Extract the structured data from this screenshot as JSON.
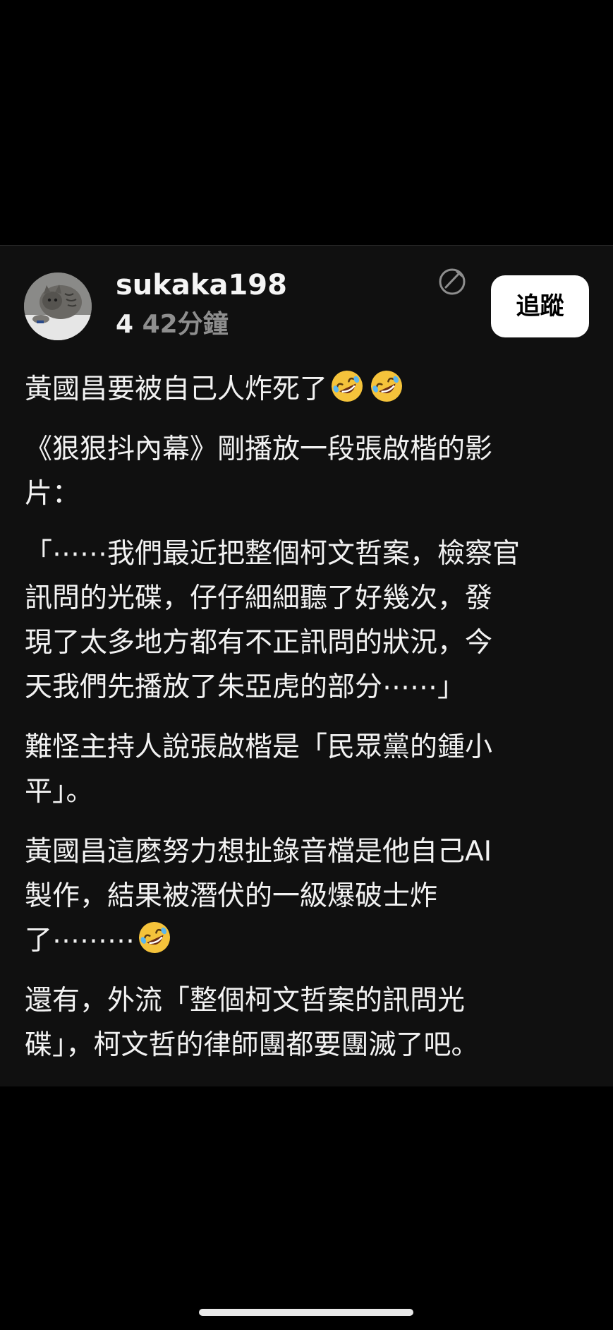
{
  "post": {
    "author": {
      "username": "sukaka198",
      "avatar_icon": "cat-avatar"
    },
    "meta": {
      "count": "4",
      "time": "42分鐘"
    },
    "follow_label": "追蹤",
    "edit_icon": "edited-icon",
    "paragraphs": [
      {
        "text": "黃國昌要被自己人炸死了",
        "trailing_emoji": [
          "rolling-on-floor-laughing-emoji",
          "rolling-on-floor-laughing-emoji"
        ]
      },
      {
        "text": "《狠狠抖內幕》剛播放一段張啟楷的影\n片："
      },
      {
        "text": "「⋯⋯我們最近把整個柯文哲案，檢察官\n訊問的光碟，仔仔細細聽了好幾次，發\n現了太多地方都有不正訊問的狀況，今\n天我們先播放了朱亞虎的部分⋯⋯」"
      },
      {
        "text": "難怪主持人說張啟楷是「民眾黨的鍾小\n平」。"
      },
      {
        "text": "黃國昌這麼努力想扯錄音檔是他自己AI\n製作，結果被潛伏的一級爆破士炸\n了⋯⋯⋯",
        "trailing_emoji": [
          "rolling-on-floor-laughing-emoji"
        ]
      },
      {
        "text": "還有，外流「整個柯文哲案的訊問光\n碟」，柯文哲的律師團都要團滅了吧。"
      }
    ]
  },
  "colors": {
    "background": "#000000",
    "card": "#101010",
    "text": "#f2f2f2",
    "muted": "#8e8e8e",
    "button_bg": "#ffffff",
    "button_text": "#000000"
  }
}
